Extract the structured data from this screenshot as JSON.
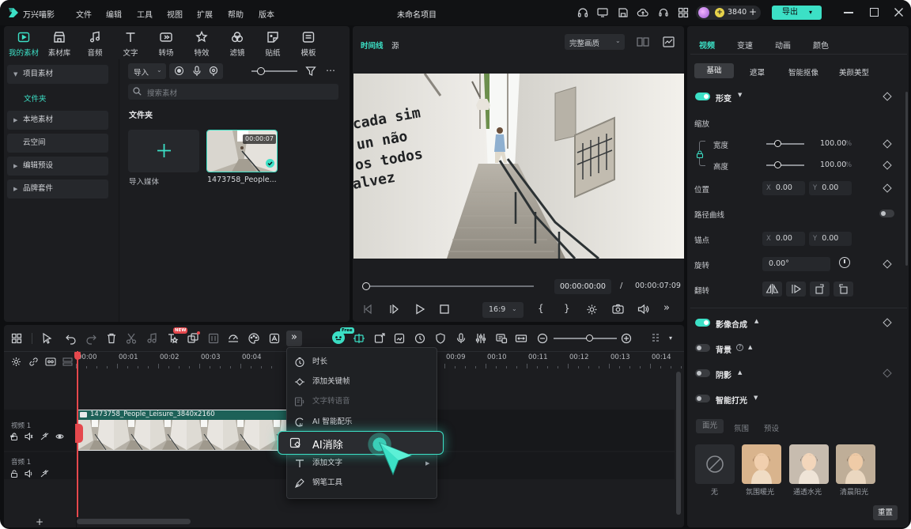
{
  "app": {
    "name": "万兴喵影",
    "project_title": "未命名项目"
  },
  "menu": [
    "文件",
    "编辑",
    "工具",
    "视图",
    "扩展",
    "帮助",
    "版本"
  ],
  "account": {
    "credits": "3840",
    "export_label": "导出"
  },
  "media_tabs": [
    {
      "label": "我的素材",
      "icon": "folder-icon"
    },
    {
      "label": "素材库",
      "icon": "store-icon"
    },
    {
      "label": "音频",
      "icon": "music-icon"
    },
    {
      "label": "文字",
      "icon": "text-icon"
    },
    {
      "label": "转场",
      "icon": "transition-icon"
    },
    {
      "label": "特效",
      "icon": "effects-icon"
    },
    {
      "label": "滤镜",
      "icon": "filter-icon"
    },
    {
      "label": "贴纸",
      "icon": "sticker-icon"
    },
    {
      "label": "模板",
      "icon": "template-icon"
    }
  ],
  "sidebar": {
    "project_media": "项目素材",
    "folder": "文件夹",
    "local_media": "本地素材",
    "cloud": "云空间",
    "edit_presets": "编辑预设",
    "brand_kit": "品牌套件"
  },
  "media_panel": {
    "import_label": "导入",
    "search_placeholder": "搜索素材",
    "folder_heading": "文件夹",
    "import_media_label": "导入媒体",
    "clip_name": "1473758_People...",
    "clip_duration": "00:00:07"
  },
  "preview": {
    "tab_timeline": "时间线",
    "tab_source": "源",
    "quality": "完整画质",
    "current_time": "00:00:00:00",
    "separator": "/",
    "total_time": "00:00:07:09",
    "aspect": "16:9",
    "scene_text": [
      "cada sim",
      "un não",
      "os todos",
      "alvez"
    ]
  },
  "inspector": {
    "tabs": [
      "视频",
      "变速",
      "动画",
      "颜色"
    ],
    "subtabs": [
      "基础",
      "遮罩",
      "智能抠像",
      "美颜美型"
    ],
    "transform": "形变",
    "scale": "缩放",
    "width": "宽度",
    "width_value": "100.00",
    "height": "高度",
    "height_value": "100.00",
    "percent": "%",
    "position": "位置",
    "pos_x": "0.00",
    "pos_y": "0.00",
    "path_curve": "路径曲线",
    "anchor": "锚点",
    "anchor_x": "0.00",
    "anchor_y": "0.00",
    "rotate": "旋转",
    "rotate_value": "0.00°",
    "flip": "翻转",
    "x_label": "X",
    "y_label": "Y",
    "compositing": "影像合成",
    "background": "背景",
    "shadow": "阴影",
    "smart_light": "智能打光",
    "light_tabs": [
      "面光",
      "氛围",
      "预设"
    ],
    "presets": [
      "无",
      "氛围暖光",
      "通透水光",
      "清晨阳光"
    ],
    "reset": "重置"
  },
  "timeline": {
    "ticks": [
      "00:00",
      "00:01",
      "00:02",
      "00:03",
      "00:04",
      "00:09",
      "00:10",
      "00:11",
      "00:12",
      "00:13",
      "00:14"
    ],
    "video_track": "视频 1",
    "audio_track": "音频 1",
    "clip_label": "1473758_People_Leisure_3840x2160",
    "new_badge": "NEW",
    "free_badge": "Free"
  },
  "context_menu": {
    "items": [
      "时长",
      "添加关键帧",
      "文字转语音",
      "AI 智能配乐",
      "AI消除",
      "添加文字",
      "钢笔工具"
    ]
  },
  "colors": {
    "accent": "#3ce0c6",
    "bg": "#0e0f11",
    "panel": "#1c1d20",
    "playhead": "#e5484d"
  }
}
